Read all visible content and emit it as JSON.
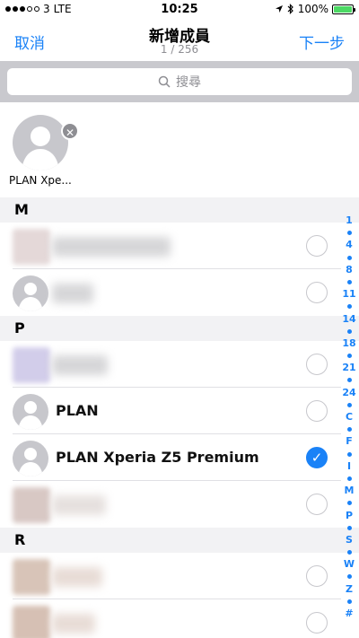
{
  "status_bar": {
    "carrier": "3",
    "network": "LTE",
    "time": "10:25",
    "battery": "100%"
  },
  "nav": {
    "cancel_label": "取消",
    "title": "新增成員",
    "subtitle": "1 / 256",
    "next_label": "下一步"
  },
  "search": {
    "placeholder": "搜尋"
  },
  "selected": {
    "name": "PLAN Xpe..."
  },
  "sections": [
    {
      "letter": "M"
    },
    {
      "letter": "P"
    },
    {
      "letter": "R"
    }
  ],
  "contacts": {
    "plan": "PLAN",
    "plan_xperia": "PLAN Xperia Z5 Premium"
  },
  "index": [
    "1",
    "4",
    "8",
    "11",
    "14",
    "18",
    "21",
    "24",
    "C",
    "F",
    "I",
    "M",
    "P",
    "S",
    "W",
    "Z",
    "#"
  ],
  "colors": {
    "accent": "#1a82f7",
    "battery": "#4cd964"
  }
}
